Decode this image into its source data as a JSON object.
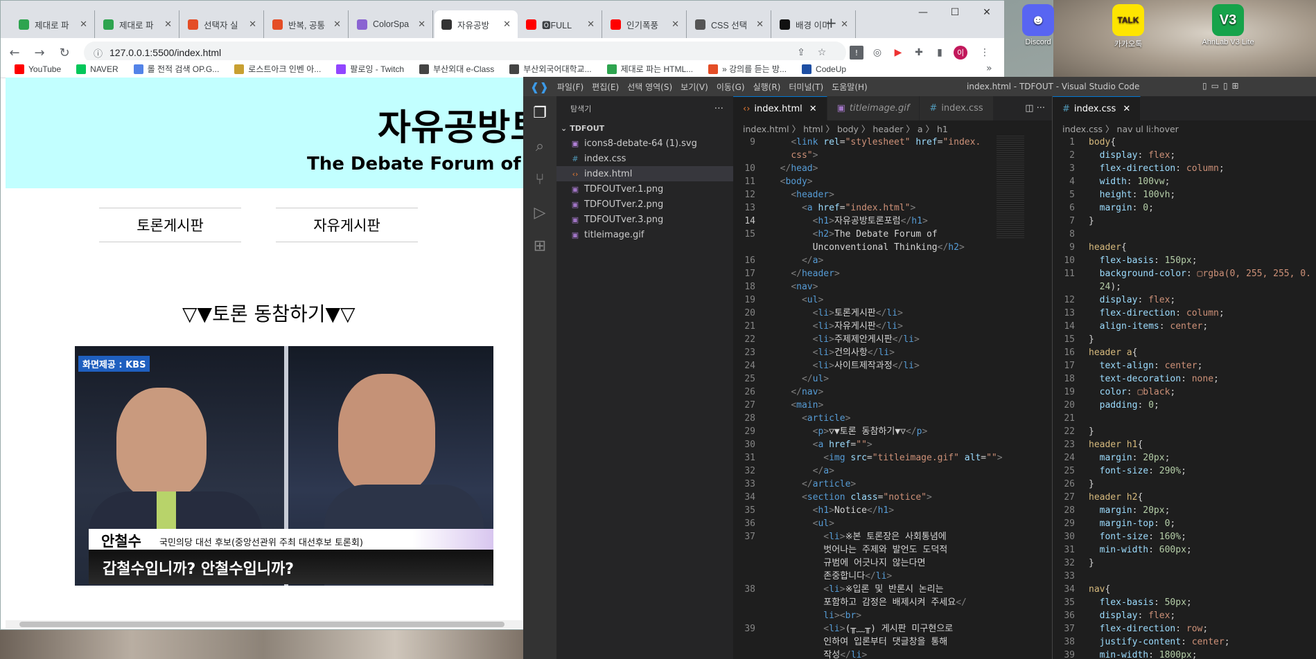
{
  "browser": {
    "tabs": [
      {
        "title": "제대로 파",
        "icon": "leetcode-icon",
        "color": "#2ea44f"
      },
      {
        "title": "제대로 파",
        "icon": "leetcode-icon",
        "color": "#2ea44f"
      },
      {
        "title": "선택자 실",
        "icon": "w3-icon",
        "color": "#e44d26"
      },
      {
        "title": "반복, 공통",
        "icon": "w3-icon",
        "color": "#e44d26"
      },
      {
        "title": "ColorSpa",
        "icon": "colorspace-icon",
        "color": "#8a63d2"
      },
      {
        "title": "자유공방",
        "icon": "speech-icon",
        "color": "#333333"
      },
      {
        "title": "🅾FULL",
        "icon": "youtube-icon",
        "color": "#ff0000"
      },
      {
        "title": "인기폭풍",
        "icon": "youtube-icon",
        "color": "#ff0000"
      },
      {
        "title": "CSS 선택",
        "icon": "grid-icon",
        "color": "#555555"
      },
      {
        "title": "배경 이미",
        "icon": "m-icon",
        "color": "#111111"
      }
    ],
    "url": "127.0.0.1:5500/index.html",
    "bookmarks": [
      {
        "label": "YouTube",
        "color": "#ff0000"
      },
      {
        "label": "NAVER",
        "color": "#03c75a"
      },
      {
        "label": "롤 전적 검색 OP.G...",
        "color": "#5383e8"
      },
      {
        "label": "로스트아크 인벤 아...",
        "color": "#c8a032"
      },
      {
        "label": "팔로잉 - Twitch",
        "color": "#9146ff"
      },
      {
        "label": "부산외대 e-Class",
        "color": "#444444"
      },
      {
        "label": "부산외국어대학교...",
        "color": "#444444"
      },
      {
        "label": "제대로 파는 HTML...",
        "color": "#2ea44f"
      },
      {
        "label": "» 강의를 듣는 방...",
        "color": "#e44d26"
      },
      {
        "label": "CodeUp",
        "color": "#1e4fa3"
      }
    ],
    "more": "»",
    "profile": "이"
  },
  "page": {
    "h1": "자유공방토",
    "h2": "The Debate Forum of Unc",
    "nav": [
      "토론게시판",
      "자유게시판"
    ],
    "debate": "▽▼토론 동참하기▼▽",
    "image": {
      "badge": "화면제공 : KBS",
      "name": "안철수",
      "desc": "국민의당 대선 후보(중앙선관위 주최 대선후보 토론회)",
      "caption": "갑철수입니까? 안철수입니까?"
    }
  },
  "desktop": {
    "icons": [
      {
        "label": "Discord",
        "color": "#5865f2"
      },
      {
        "label": "카카오톡",
        "color": "#fee500"
      },
      {
        "label": "AhnLab V3 Lite",
        "color": "#16a34a"
      }
    ]
  },
  "vscode": {
    "menu": [
      "파일(F)",
      "편집(E)",
      "선택 영역(S)",
      "보기(V)",
      "이동(G)",
      "실행(R)",
      "터미널(T)",
      "도움말(H)"
    ],
    "title": "index.html - TDFOUT - Visual Studio Code",
    "explorer_title": "탐색기",
    "folder": "TDFOUT",
    "files": [
      {
        "name": "icons8-debate-64 (1).svg",
        "icon": "svg-icon",
        "color": "#b180d7"
      },
      {
        "name": "index.css",
        "icon": "css-icon",
        "color": "#519aba"
      },
      {
        "name": "index.html",
        "icon": "html-icon",
        "color": "#e37933"
      },
      {
        "name": "TDFOUTver.1.png",
        "icon": "image-icon",
        "color": "#a074c4"
      },
      {
        "name": "TDFOUTver.2.png",
        "icon": "image-icon",
        "color": "#a074c4"
      },
      {
        "name": "TDFOUTver.3.png",
        "icon": "image-icon",
        "color": "#a074c4"
      },
      {
        "name": "titleimage.gif",
        "icon": "image-icon",
        "color": "#a074c4"
      }
    ],
    "editor1_tabs": [
      "index.html",
      "titleimage.gif",
      "index.css"
    ],
    "editor1_crumb": "index.html 〉 html 〉 body 〉 header 〉 a 〉 h1",
    "editor2_tab": "index.css",
    "editor2_crumb": "index.css 〉 nav ul li:hover"
  }
}
